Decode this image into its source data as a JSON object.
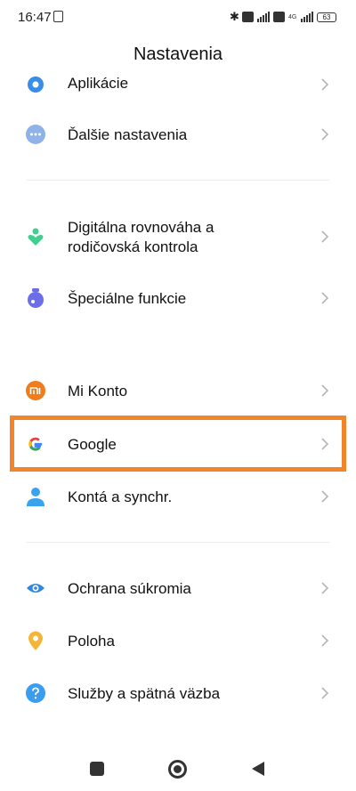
{
  "status_bar": {
    "time": "16:47",
    "battery": "63",
    "network": "4G"
  },
  "header": {
    "title": "Nastavenia"
  },
  "settings": {
    "groups": [
      {
        "items": [
          {
            "label": "Aplikácie",
            "icon": "gear-icon",
            "color": "#3a8de6"
          },
          {
            "label": "Ďalšie nastavenia",
            "icon": "more-dots-icon",
            "color": "#8fb2e8"
          }
        ]
      },
      {
        "items": [
          {
            "label_line1": "Digitálna rovnováha a",
            "label_line2": "rodičovská kontrola",
            "icon": "digital-wellbeing-icon",
            "color": "#3fcf8e"
          },
          {
            "label": "Špeciálne funkcie",
            "icon": "accessibility-icon",
            "color": "#6b6ee8"
          }
        ]
      },
      {
        "items": [
          {
            "label": "Mi Konto",
            "icon": "mi-logo-icon",
            "color": "#f07c1a"
          },
          {
            "label": "Google",
            "icon": "google-logo-icon",
            "color": "#4285f4",
            "highlighted": true
          },
          {
            "label": "Kontá a synchr.",
            "icon": "person-icon",
            "color": "#3aa3ee"
          }
        ]
      },
      {
        "items": [
          {
            "label": "Ochrana súkromia",
            "icon": "eye-icon",
            "color": "#2f88e0"
          },
          {
            "label": "Poloha",
            "icon": "location-pin-icon",
            "color": "#f4b63a"
          },
          {
            "label": "Služby a spätná väzba",
            "icon": "help-icon",
            "color": "#3a9df0"
          }
        ]
      }
    ]
  },
  "highlight_color": "#f2852a",
  "nav_bar": {
    "buttons": [
      "recents-icon",
      "home-icon",
      "back-icon"
    ]
  }
}
